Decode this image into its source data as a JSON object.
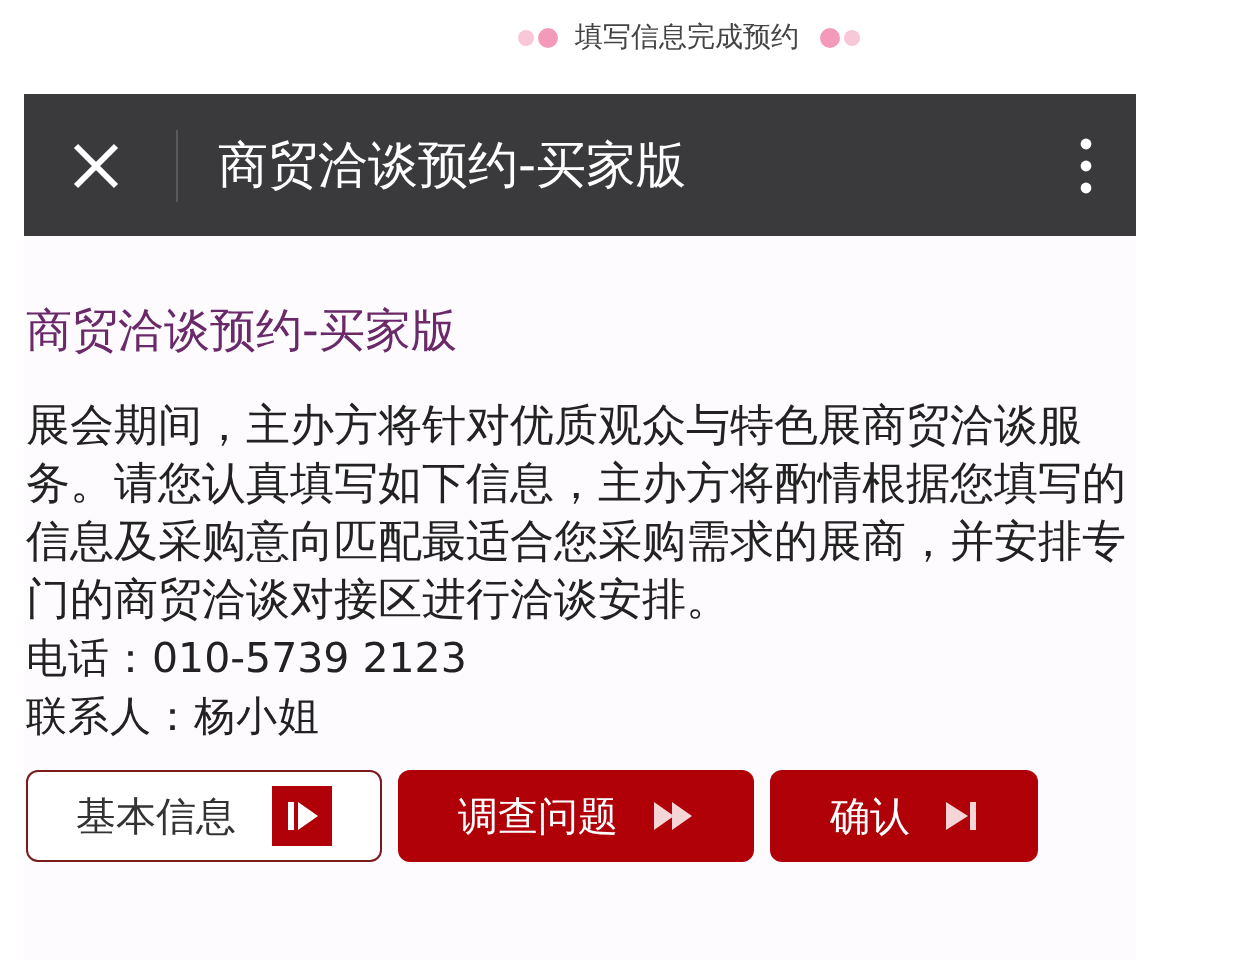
{
  "caption": "填写信息完成预约",
  "header": {
    "title": "商贸洽谈预约-买家版"
  },
  "content": {
    "title": "商贸洽谈预约-买家版",
    "paragraph": "展会期间，主办方将针对优质观众与特色展商贸洽谈服务。请您认真填写如下信息，主办方将酌情根据您填写的信息及采购意向匹配最适合您采购需求的展商，并安排专门的商贸洽谈对接区进行洽谈安排。",
    "phone": "电话：010-5739 2123",
    "contact": "联系人：杨小姐"
  },
  "steps": [
    {
      "label": "基本信息",
      "kind": "play",
      "selected": true
    },
    {
      "label": "调查问题",
      "kind": "forward",
      "selected": false
    },
    {
      "label": "确认",
      "kind": "end",
      "selected": false
    }
  ]
}
